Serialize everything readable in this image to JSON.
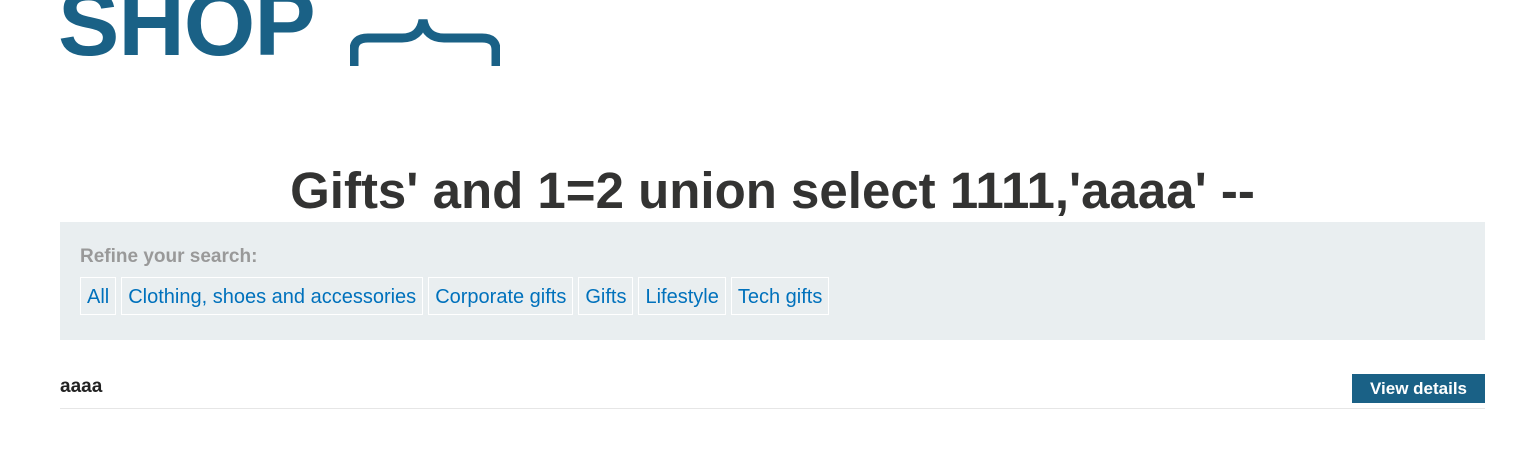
{
  "logo": {
    "text": "SHOP"
  },
  "page_title": "Gifts' and 1=2 union select 1111,'aaaa' --",
  "filter": {
    "label": "Refine your search:",
    "links": [
      "All",
      "Clothing, shoes and accessories",
      "Corporate gifts",
      "Gifts",
      "Lifestyle",
      "Tech gifts"
    ]
  },
  "results": [
    {
      "name": "aaaa",
      "button": "View details"
    }
  ],
  "colors": {
    "brand": "#1a6186",
    "link": "#0071bc",
    "panel": "#e9eef0",
    "title": "#333332"
  }
}
